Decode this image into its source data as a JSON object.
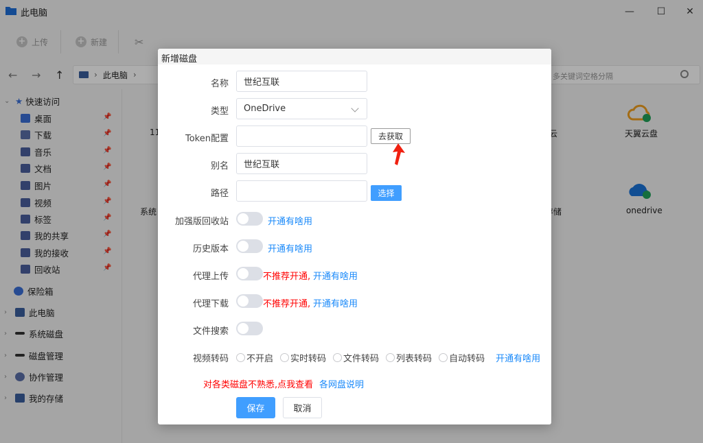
{
  "window": {
    "title": "此电脑"
  },
  "toolbar": {
    "upload": "上传",
    "new": "新建"
  },
  "address": {
    "crumb": "此电脑",
    "search_placeholder": "多关键词空格分隔"
  },
  "sidebar": {
    "quick_access": "快速访问",
    "items": [
      "桌面",
      "下载",
      "音乐",
      "文档",
      "图片",
      "视频",
      "标签",
      "我的共享",
      "我的接收",
      "回收站"
    ],
    "safe": "保险箱",
    "this_pc": "此电脑",
    "system_disk": "系统磁盘",
    "disk_manage": "磁盘管理",
    "collab": "协作管理",
    "my_storage": "我的存储"
  },
  "tiles": {
    "tianyi": "天翼云盘",
    "onedrive": "onedrive",
    "partial_yun": "云",
    "partial_11": "11",
    "partial_sys": "系统",
    "partial_store": "存储"
  },
  "dialog": {
    "title": "新增磁盘",
    "name_label": "名称",
    "name_value": "世纪互联",
    "type_label": "类型",
    "type_value": "OneDrive",
    "token_label": "Token配置",
    "token_value": "",
    "get_button": "去获取",
    "alias_label": "别名",
    "alias_value": "世纪互联",
    "path_label": "路径",
    "path_value": "",
    "choose_button": "选择",
    "recycle_label": "加强版回收站",
    "history_label": "历史版本",
    "proxy_upload_label": "代理上传",
    "proxy_download_label": "代理下载",
    "file_search_label": "文件搜索",
    "video_label": "视频转码",
    "what_link": "开通有啥用",
    "not_recommended": "不推荐开通,",
    "radios": [
      "不开启",
      "实时转码",
      "文件转码",
      "列表转码",
      "自动转码"
    ],
    "help_text": "对各类磁盘不熟悉,点我查看",
    "help_link": "各网盘说明",
    "save_button": "保存",
    "cancel_button": "取消"
  },
  "colors": {
    "primary": "#409eff",
    "link": "#1989fa",
    "warn": "#ff0000"
  }
}
